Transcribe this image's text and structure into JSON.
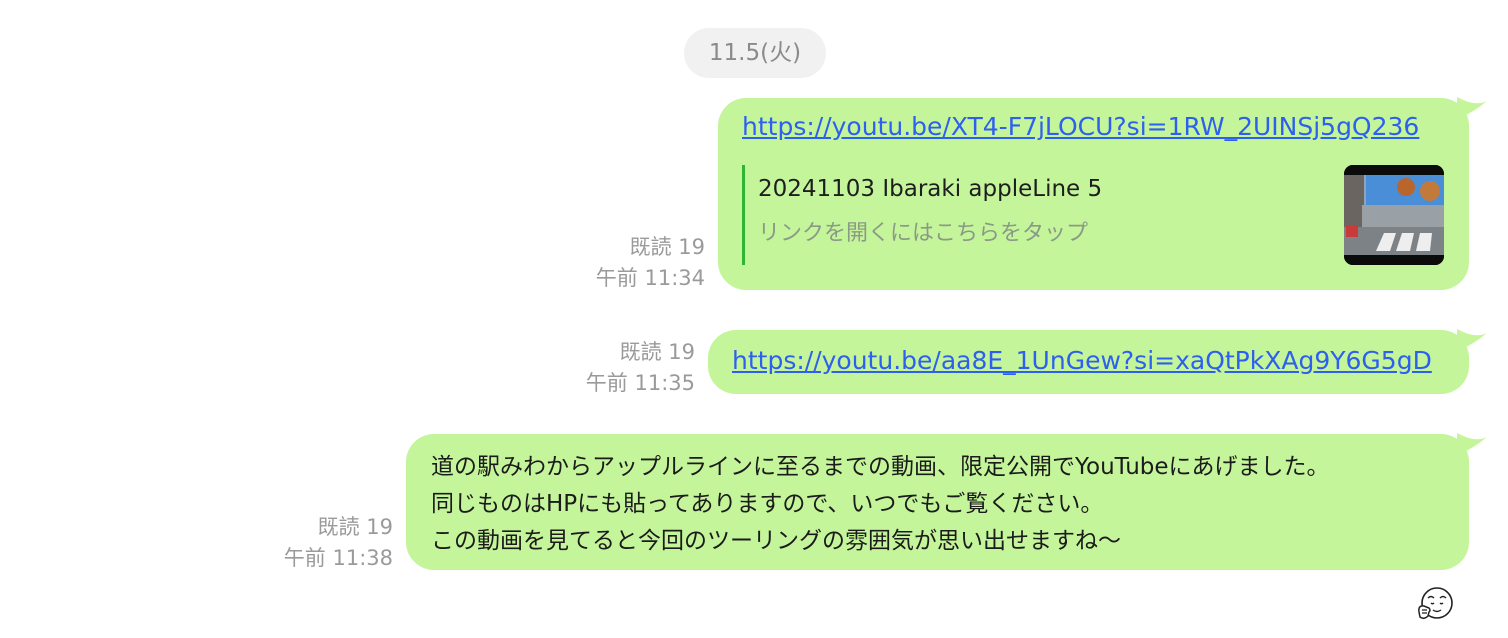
{
  "date_separator": "11.5(火)",
  "messages": [
    {
      "read_status": "既読 19",
      "time": "午前 11:34",
      "link": "https://youtu.be/XT4-F7jLOCU?si=1RW_2UINSj5gQ236",
      "preview": {
        "title": "20241103 Ibaraki appleLine 5",
        "subtitle": "リンクを開くにはこちらをタップ"
      }
    },
    {
      "read_status": "既読 19",
      "time": "午前 11:35",
      "link": "https://youtu.be/aa8E_1UnGew?si=xaQtPkXAg9Y6G5gD"
    },
    {
      "read_status": "既読 19",
      "time": "午前 11:38",
      "lines": [
        "道の駅みわからアップルラインに至るまでの動画、限定公開でYouTubeにあげました。",
        "同じものはHPにも貼ってありますので、いつでもご覧ください。",
        "この動画を見てると今回のツーリングの雰囲気が思い出せますね〜"
      ]
    }
  ],
  "colors": {
    "bubble": "#c5f59a",
    "link": "#2d5ff0",
    "preview_bar": "#2fb532",
    "meta_text": "#9a9a9a"
  }
}
